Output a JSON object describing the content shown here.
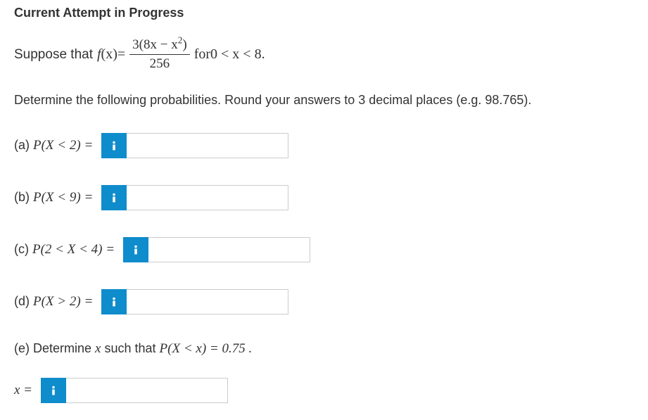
{
  "header": "Current Attempt in Progress",
  "suppose_text": "Suppose that ",
  "func_name": "f",
  "func_arg": "(x)",
  "equals": " = ",
  "numerator": "3(8x − x",
  "numerator_sup": "2",
  "numerator_close": ")",
  "denominator": "256",
  "for_text": " for ",
  "range": "0 < x < 8.",
  "instruction": "Determine the following probabilities. Round your answers to 3 decimal places (e.g. 98.765).",
  "parts": {
    "a": {
      "paren": "(a) ",
      "prob": "P(X < 2) = "
    },
    "b": {
      "paren": "(b)  ",
      "prob": "P(X < 9) = "
    },
    "c": {
      "paren": "(c) ",
      "prob": "P(2 < X < 4) = "
    },
    "d": {
      "paren": "(d) ",
      "prob": "P(X > 2) = "
    }
  },
  "part_e": {
    "paren": "(e) ",
    "text1": "Determine ",
    "var": "x",
    "text2": " such that ",
    "prob": "P(X < x) = 0.75 ."
  },
  "x_label": "x = "
}
